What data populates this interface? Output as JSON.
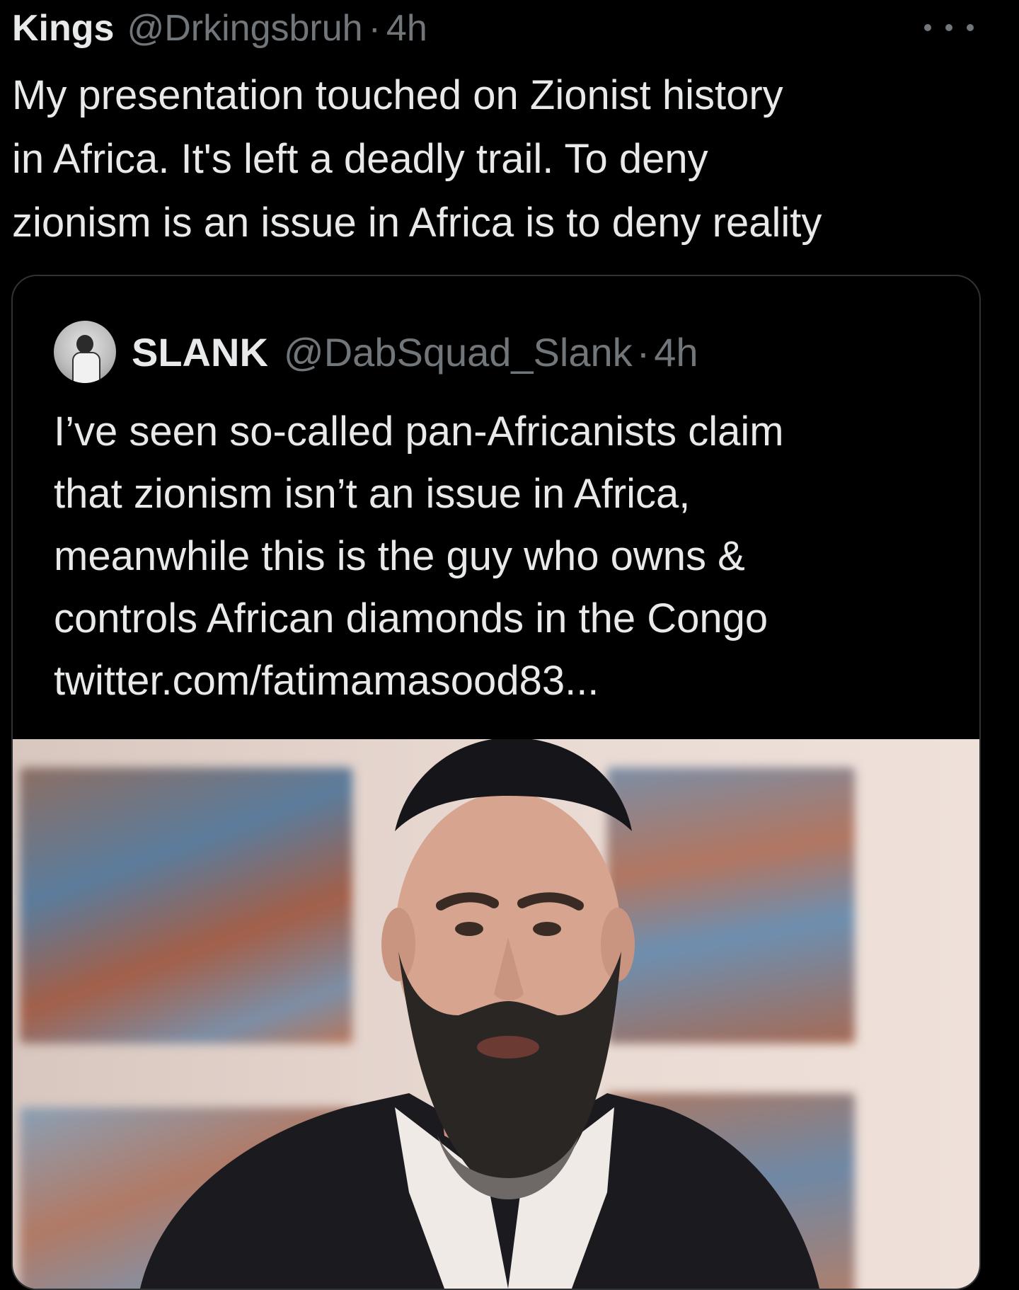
{
  "tweet": {
    "author_name": "Kings",
    "author_handle": "@Drkingsbruh",
    "separator": "·",
    "time": "4h",
    "lines": [
      "My presentation touched on Zionist history",
      "in Africa. It's left a deadly trail. To deny",
      "zionism is an issue in Africa is to deny reality"
    ]
  },
  "quoted": {
    "author_name": "SLANK",
    "author_handle": "@DabSquad_Slank",
    "separator": "·",
    "time": "4h",
    "lines": [
      "I’ve seen so-called pan-Africanists claim",
      "that zionism isn’t an issue in Africa,",
      "meanwhile this is the guy who owns &",
      "controls African diamonds in the Congo",
      "twitter.com/fatimamasood83..."
    ]
  },
  "icons": {
    "more": "more-icon",
    "avatar": "avatar-image"
  },
  "colors": {
    "background": "#000000",
    "text_primary": "#e7e9ea",
    "text_secondary": "#71767b",
    "card_border": "#2f3336"
  }
}
